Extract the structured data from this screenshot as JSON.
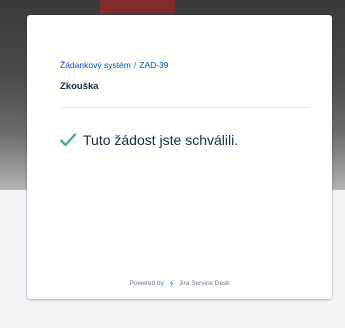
{
  "breadcrumb": {
    "project": "Žádankový systém",
    "separator": "/",
    "issue_key": "ZAD-39"
  },
  "request": {
    "title": "Zkouška"
  },
  "status": {
    "icon": "check-icon",
    "message": "Tuto žádost jste schválili.",
    "color": "#36b37e"
  },
  "footer": {
    "powered_by": "Powered by",
    "product_icon": "jira-service-desk-icon",
    "product": "Jira Service Desk"
  },
  "colors": {
    "link": "#0052cc",
    "text": "#172b4d",
    "muted": "#6b778c",
    "jira": "#2684ff"
  }
}
